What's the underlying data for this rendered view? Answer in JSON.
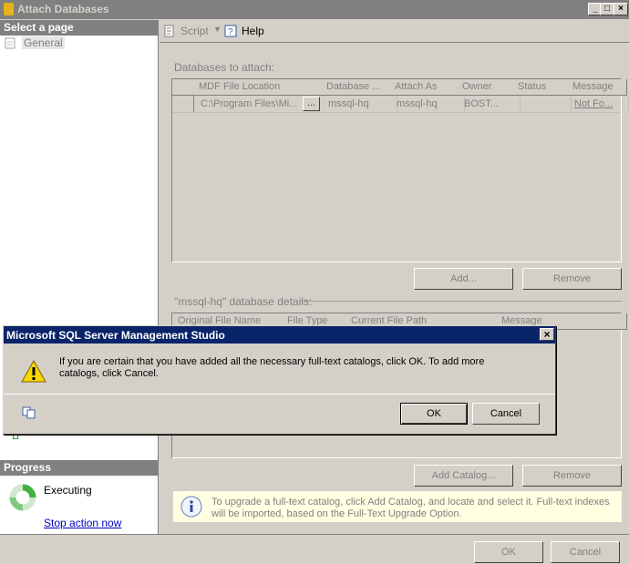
{
  "window": {
    "title": "Attach Databases",
    "controls": [
      "_",
      "□",
      "×"
    ]
  },
  "left": {
    "select_page": "Select a page",
    "pages": [
      "General"
    ],
    "progress": "Progress",
    "progress_status": "Executing",
    "stop_action": "Stop action now"
  },
  "toolbar": {
    "script": "Script",
    "help": "Help"
  },
  "attach": {
    "label": "Databases to attach:",
    "columns": [
      "MDF File Location",
      "Database ...",
      "Attach As",
      "Owner",
      "Status",
      "Message"
    ],
    "rows": [
      {
        "mdf": "C:\\Program Files\\Mi...",
        "browse": "...",
        "database": "mssql-hq",
        "attach_as": "mssql-hq",
        "owner": "BOST...",
        "status": "",
        "message": "Not Fo..."
      }
    ],
    "add": "Add...",
    "remove": "Remove"
  },
  "details": {
    "label": "\"mssql-hq\" database details:",
    "columns": [
      "Original File Name",
      "File Type",
      "Current File Path",
      "Message"
    ],
    "add_catalog": "Add Catalog...",
    "remove": "Remove"
  },
  "info": {
    "text": "To upgrade a full-text catalog, click Add Catalog, and locate and select it. Full-text indexes will be imported, based on the Full-Text Upgrade Option."
  },
  "footer": {
    "ok": "OK",
    "cancel": "Cancel"
  },
  "dialog": {
    "title": "Microsoft SQL Server Management Studio",
    "close": "×",
    "message": "If you are certain that you have added all the necessary full-text catalogs, click OK. To add more catalogs, click Cancel.",
    "ok": "OK",
    "cancel": "Cancel"
  }
}
